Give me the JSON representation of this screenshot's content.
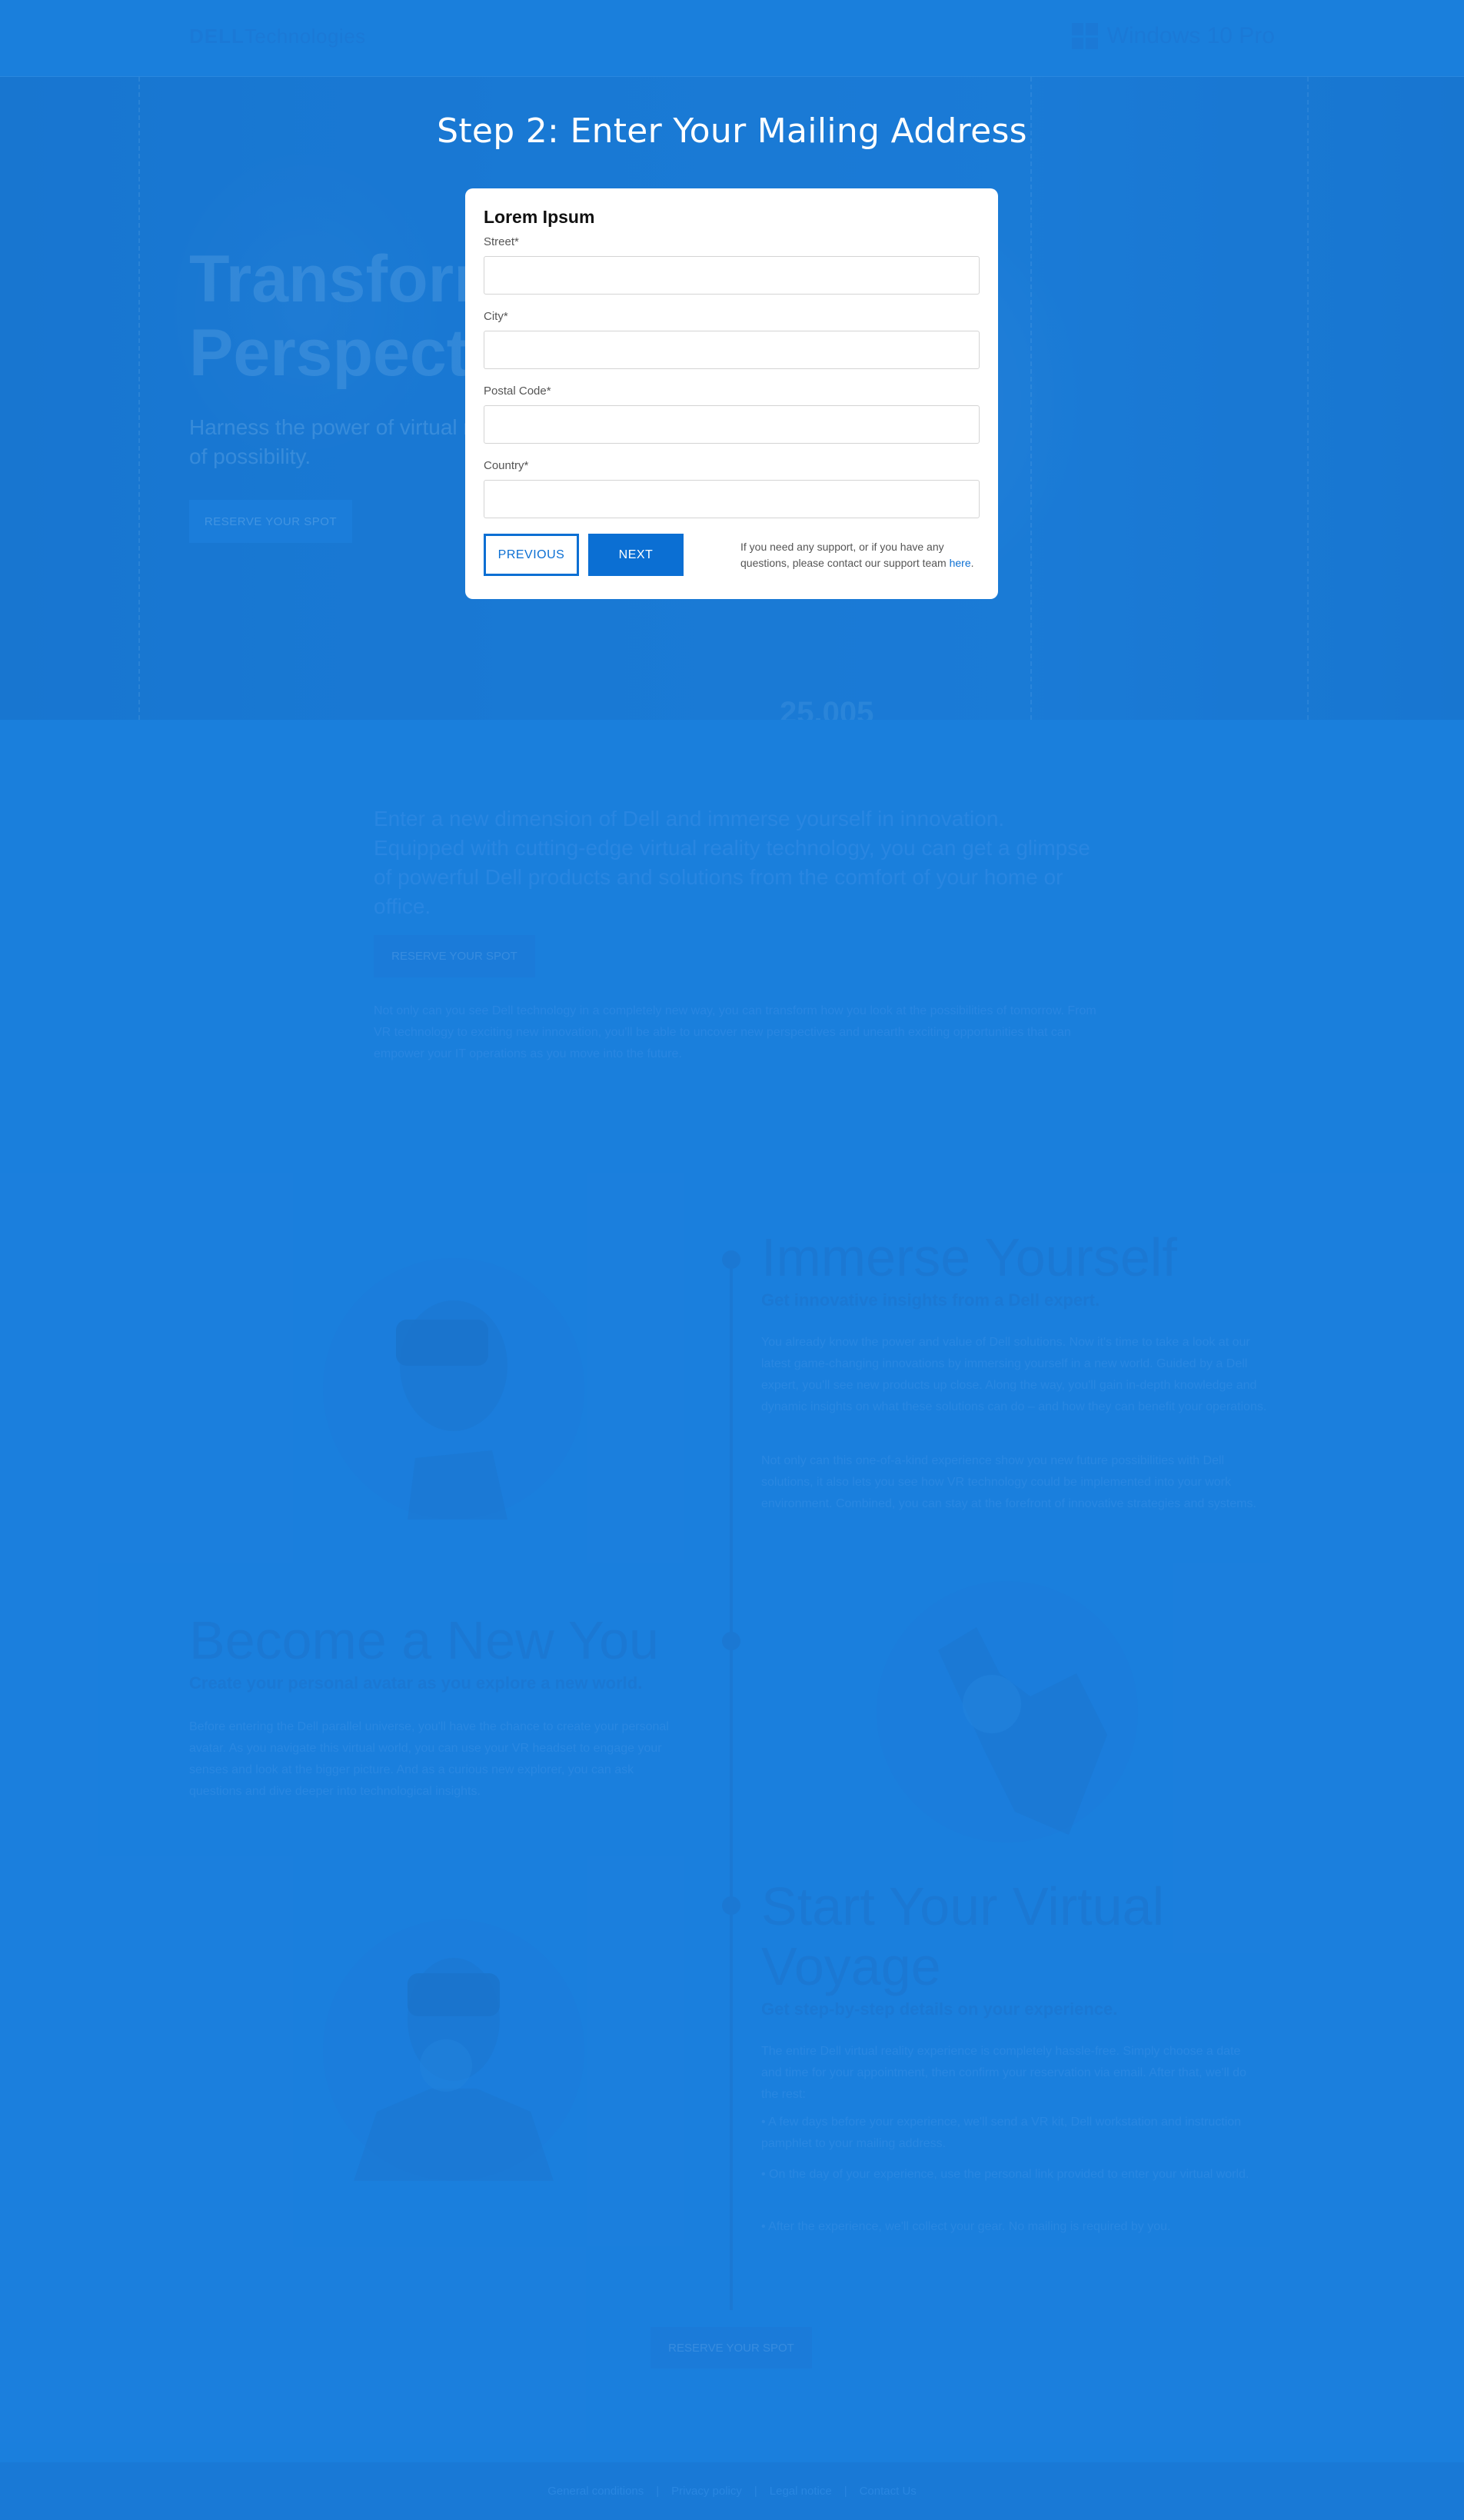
{
  "header": {
    "brand_bold": "DELL",
    "brand_light": "Technologies",
    "windows_label": "Windows 10 Pro"
  },
  "hero": {
    "title": "Transform Your Perspective",
    "subtitle": "Harness the power of virtual reality to open up a world of possibility.",
    "button": "RESERVE YOUR SPOT",
    "counter": "25,005"
  },
  "intro": {
    "lead": "Enter a new dimension of Dell and immerse yourself in innovation. Equipped with cutting-edge virtual reality technology, you can get a glimpse of powerful Dell products and solutions from the comfort of your home or office.",
    "button": "RESERVE YOUR SPOT",
    "text": "Not only can you see Dell technology in a completely new way, you can transform how you look at the possibilities of tomorrow. From VR technology to exciting new innovation, you'll be able to uncover new perspectives and unearth exciting opportunities that can empower your IT operations as you move into the future."
  },
  "timeline": {
    "items": [
      {
        "heading": "Immerse Yourself",
        "subheading": "Get innovative insights from a Dell expert.",
        "paragraphs": [
          "You already know the power and value of Dell solutions. Now it's time to take a look at our latest game-changing innovations by immersing yourself in a new world. Guided by a Dell expert, you'll see new products up close. Along the way, you'll gain in-depth knowledge and dynamic insights on what these solutions can do – and how they can benefit your operations.",
          "Not only can this one-of-a-kind experience show you new future possibilities with Dell solutions, it also lets you see how VR technology could be implemented into your work environment. Combined, you can stay at the forefront of innovative strategies and systems."
        ]
      },
      {
        "heading": "Become a New You",
        "subheading": "Create your personal avatar as you explore a new world.",
        "paragraphs": [
          "Before entering the Dell parallel universe, you'll have the chance to create your personal avatar. As you navigate this virtual world, you can use your VR headset to engage your senses and look at the bigger picture. And as a curious new explorer, you can ask questions and dive deeper into technological insights."
        ]
      },
      {
        "heading": "Start Your Virtual Voyage",
        "subheading": "Get step-by-step details on your experience.",
        "paragraphs": [
          "The entire Dell virtual reality experience is completely hassle-free. Simply choose a date and time for your appointment, then confirm your reservation via email. After that, we'll do the rest:",
          "• A few days before your experience, we'll send a VR kit, Dell workstation and instruction pamphlet to your mailing address.",
          "• On the day of your experience, use the personal link provided to enter your virtual world.",
          "• After the experience, we'll collect your gear. No mailing is required by you."
        ]
      }
    ],
    "button": "RESERVE YOUR SPOT"
  },
  "footer": {
    "links": [
      "General conditions",
      "Privacy policy",
      "Legal notice",
      "Contact Us"
    ]
  },
  "modal": {
    "step_title": "Step 2: Enter Your Mailing Address",
    "card_title": "Lorem Ipsum",
    "fields": [
      {
        "label": "Street*",
        "value": ""
      },
      {
        "label": "City*",
        "value": ""
      },
      {
        "label": "Postal Code*",
        "value": ""
      },
      {
        "label": "Country*",
        "value": ""
      }
    ],
    "previous_label": "PREVIOUS",
    "next_label": "NEXT",
    "support_text": "If you need any support, or if you have any questions, please contact our support team ",
    "support_link": "here",
    "support_end": "."
  }
}
